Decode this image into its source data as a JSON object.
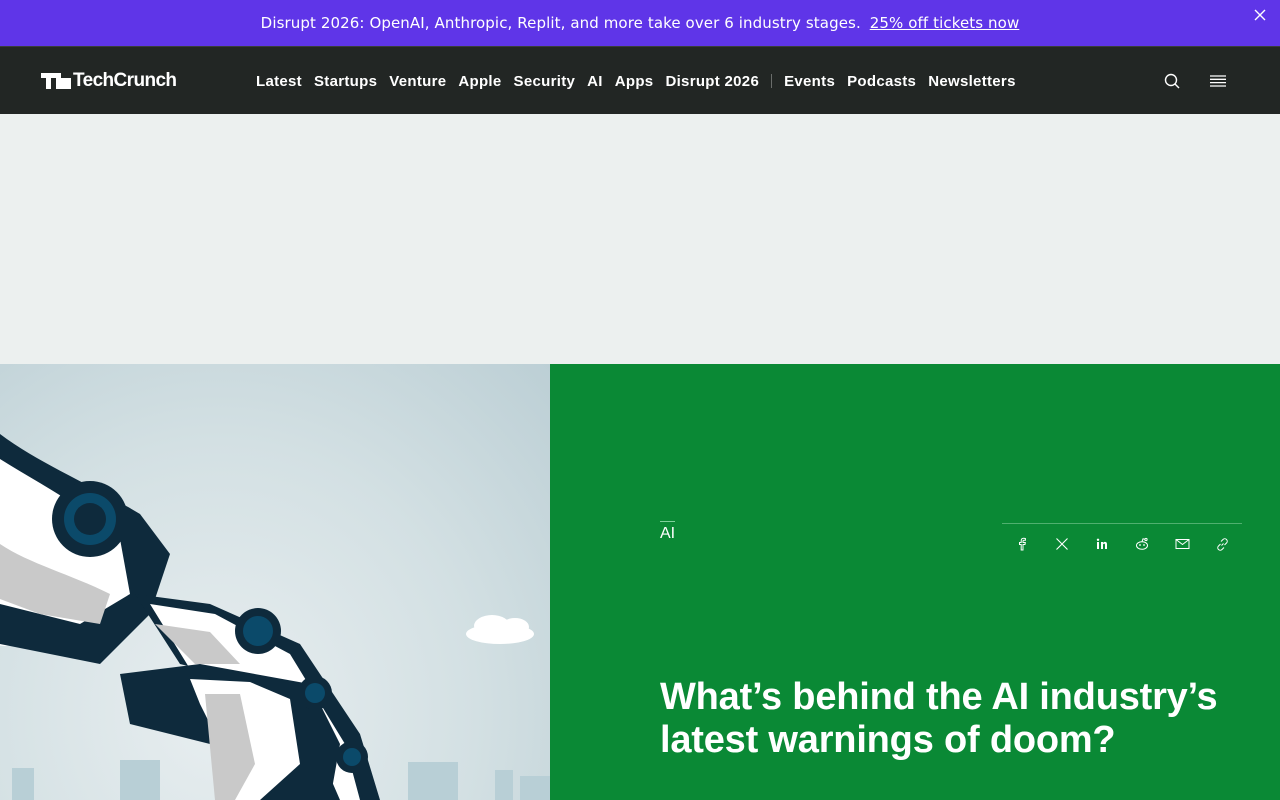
{
  "promo": {
    "message": "Disrupt 2026: OpenAI, Anthropic, Replit, and more take over 6 industry stages.",
    "cta": "25% off tickets now"
  },
  "header": {
    "logo_text": "TechCrunch",
    "nav_items": [
      "Latest",
      "Startups",
      "Venture",
      "Apple",
      "Security",
      "AI",
      "Apps",
      "Disrupt 2026"
    ],
    "secondary_items": [
      "Events",
      "Podcasts",
      "Newsletters"
    ]
  },
  "article": {
    "category": "AI",
    "title": "What’s behind the AI industry’s latest warnings of doom?",
    "share_icons": [
      "facebook-icon",
      "x-icon",
      "linkedin-icon",
      "reddit-icon",
      "email-icon",
      "link-icon"
    ]
  },
  "colors": {
    "promo_bg": "#5f35e8",
    "nav_bg": "#222624",
    "ad_bg": "#ecf0ef",
    "hero_green": "#0a8935"
  }
}
